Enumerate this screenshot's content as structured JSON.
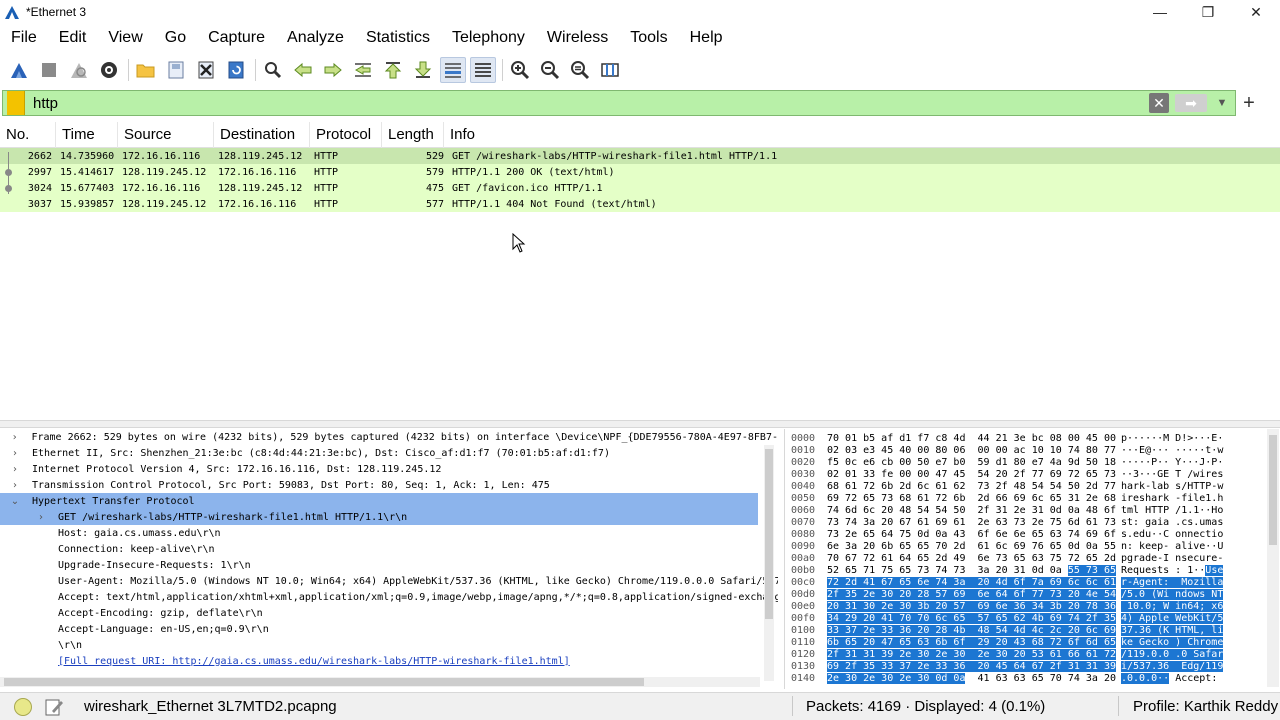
{
  "window": {
    "title": "*Ethernet 3",
    "minimize": "—",
    "restore": "❐",
    "close": "✕"
  },
  "menu": [
    "File",
    "Edit",
    "View",
    "Go",
    "Capture",
    "Analyze",
    "Statistics",
    "Telephony",
    "Wireless",
    "Tools",
    "Help"
  ],
  "toolbar": {
    "icons": [
      "start-capture-icon",
      "stop-capture-icon",
      "restart-capture-icon",
      "capture-options-icon",
      "open-file-icon",
      "save-file-icon",
      "close-file-icon",
      "reload-file-icon",
      "find-packet-icon",
      "go-back-icon",
      "go-forward-icon",
      "go-to-packet-icon",
      "first-packet-icon",
      "last-packet-icon",
      "auto-scroll-icon",
      "colorize-icon",
      "zoom-in-icon",
      "zoom-out-icon",
      "normal-size-icon",
      "resize-columns-icon"
    ]
  },
  "filter": {
    "value": "http",
    "clear": "✕",
    "apply": "➡",
    "dropdown": "▼",
    "add": "+"
  },
  "packet_list": {
    "columns": [
      "No.",
      "Time",
      "Source",
      "Destination",
      "Protocol",
      "Length",
      "Info"
    ],
    "rows": [
      {
        "no": "2662",
        "time": "14.735960",
        "src": "172.16.16.116",
        "dst": "128.119.245.12",
        "proto": "HTTP",
        "len": "529",
        "info": "GET /wireshark-labs/HTTP-wireshark-file1.html HTTP/1.1"
      },
      {
        "no": "2997",
        "time": "15.414617",
        "src": "128.119.245.12",
        "dst": "172.16.16.116",
        "proto": "HTTP",
        "len": "579",
        "info": "HTTP/1.1 200 OK  (text/html)"
      },
      {
        "no": "3024",
        "time": "15.677403",
        "src": "172.16.16.116",
        "dst": "128.119.245.12",
        "proto": "HTTP",
        "len": "475",
        "info": "GET /favicon.ico HTTP/1.1"
      },
      {
        "no": "3037",
        "time": "15.939857",
        "src": "128.119.245.12",
        "dst": "172.16.16.116",
        "proto": "HTTP",
        "len": "577",
        "info": "HTTP/1.1 404 Not Found  (text/html)"
      }
    ]
  },
  "details": [
    {
      "exp": "›",
      "text": "Frame 2662: 529 bytes on wire (4232 bits), 529 bytes captured (4232 bits) on interface \\Device\\NPF_{DDE79556-780A-4E97-8FB7-"
    },
    {
      "exp": "›",
      "text": "Ethernet II, Src: Shenzhen_21:3e:bc (c8:4d:44:21:3e:bc), Dst: Cisco_af:d1:f7 (70:01:b5:af:d1:f7)"
    },
    {
      "exp": "›",
      "text": "Internet Protocol Version 4, Src: 172.16.16.116, Dst: 128.119.245.12"
    },
    {
      "exp": "›",
      "text": "Transmission Control Protocol, Src Port: 59083, Dst Port: 80, Seq: 1, Ack: 1, Len: 475"
    },
    {
      "exp": "⌄",
      "text": "Hypertext Transfer Protocol"
    },
    {
      "exp": "›",
      "text": "GET /wireshark-labs/HTTP-wireshark-file1.html HTTP/1.1\\r\\n"
    },
    {
      "exp": "",
      "text": "Host: gaia.cs.umass.edu\\r\\n"
    },
    {
      "exp": "",
      "text": "Connection: keep-alive\\r\\n"
    },
    {
      "exp": "",
      "text": "Upgrade-Insecure-Requests: 1\\r\\n"
    },
    {
      "exp": "",
      "text": "User-Agent: Mozilla/5.0 (Windows NT 10.0; Win64; x64) AppleWebKit/537.36 (KHTML, like Gecko) Chrome/119.0.0.0 Safari/537"
    },
    {
      "exp": "",
      "text": "Accept: text/html,application/xhtml+xml,application/xml;q=0.9,image/webp,image/apng,*/*;q=0.8,application/signed-exchang"
    },
    {
      "exp": "",
      "text": "Accept-Encoding: gzip, deflate\\r\\n"
    },
    {
      "exp": "",
      "text": "Accept-Language: en-US,en;q=0.9\\r\\n"
    },
    {
      "exp": "",
      "text": "\\r\\n"
    },
    {
      "exp": "",
      "text": "[Full request URI: http://gaia.cs.umass.edu/wireshark-labs/HTTP-wireshark-file1.html]"
    }
  ],
  "bytes": [
    {
      "off": "0000",
      "hex": "70 01 b5 af d1 f7 c8 4d  44 21 3e bc 08 00 45 00",
      "asc": "p······M D!>···E·"
    },
    {
      "off": "0010",
      "hex": "02 03 e3 45 40 00 80 06  00 00 ac 10 10 74 80 77",
      "asc": "···E@··· ·····t·w"
    },
    {
      "off": "0020",
      "hex": "f5 0c e6 cb 00 50 e7 b0  59 d1 80 e7 4a 9d 50 18",
      "asc": "·····P·· Y···J·P·"
    },
    {
      "off": "0030",
      "hex": "02 01 33 fe 00 00 47 45  54 20 2f 77 69 72 65 73",
      "asc": "··3···GE T /wires"
    },
    {
      "off": "0040",
      "hex": "68 61 72 6b 2d 6c 61 62  73 2f 48 54 54 50 2d 77",
      "asc": "hark-lab s/HTTP-w"
    },
    {
      "off": "0050",
      "hex": "69 72 65 73 68 61 72 6b  2d 66 69 6c 65 31 2e 68",
      "asc": "ireshark -file1.h"
    },
    {
      "off": "0060",
      "hex": "74 6d 6c 20 48 54 54 50  2f 31 2e 31 0d 0a 48 6f",
      "asc": "tml HTTP /1.1··Ho"
    },
    {
      "off": "0070",
      "hex": "73 74 3a 20 67 61 69 61  2e 63 73 2e 75 6d 61 73",
      "asc": "st: gaia .cs.umas"
    },
    {
      "off": "0080",
      "hex": "73 2e 65 64 75 0d 0a 43  6f 6e 6e 65 63 74 69 6f",
      "asc": "s.edu··C onnectio"
    },
    {
      "off": "0090",
      "hex": "6e 3a 20 6b 65 65 70 2d  61 6c 69 76 65 0d 0a 55",
      "asc": "n: keep- alive··U"
    },
    {
      "off": "00a0",
      "hex": "70 67 72 61 64 65 2d 49  6e 73 65 63 75 72 65 2d",
      "asc": "pgrade-I nsecure-"
    },
    {
      "off": "00b0",
      "hex": "52 65 71 75 65 73 74 73  3a 20 31 0d 0a ",
      "hexhl": "55 73 65",
      "asc": "Requests : 1··",
      "aschl": "Use"
    },
    {
      "off": "00c0",
      "hexhl": "72 2d 41 67 65 6e 74 3a  20 4d 6f 7a 69 6c 6c 61",
      "aschl": "r-Agent:  Mozilla"
    },
    {
      "off": "00d0",
      "hexhl": "2f 35 2e 30 20 28 57 69  6e 64 6f 77 73 20 4e 54",
      "aschl": "/5.0 (Wi ndows NT"
    },
    {
      "off": "00e0",
      "hexhl": "20 31 30 2e 30 3b 20 57  69 6e 36 34 3b 20 78 36",
      "aschl": " 10.0; W in64; x6"
    },
    {
      "off": "00f0",
      "hexhl": "34 29 20 41 70 70 6c 65  57 65 62 4b 69 74 2f 35",
      "aschl": "4) Apple WebKit/5"
    },
    {
      "off": "0100",
      "hexhl": "33 37 2e 33 36 20 28 4b  48 54 4d 4c 2c 20 6c 69",
      "aschl": "37.36 (K HTML, li"
    },
    {
      "off": "0110",
      "hexhl": "6b 65 20 47 65 63 6b 6f  29 20 43 68 72 6f 6d 65",
      "aschl": "ke Gecko ) Chrome"
    },
    {
      "off": "0120",
      "hexhl": "2f 31 31 39 2e 30 2e 30  2e 30 20 53 61 66 61 72",
      "aschl": "/119.0.0 .0 Safar"
    },
    {
      "off": "0130",
      "hexhl": "69 2f 35 33 37 2e 33 36  20 45 64 67 2f 31 31 39",
      "aschl": "i/537.36  Edg/119"
    },
    {
      "off": "0140",
      "hexhl": "2e 30 2e 30 2e 30 0d 0a",
      "hex": "  41 63 63 65 70 74 3a 20",
      "aschl": ".0.0.0··",
      "asc": " Accept:"
    }
  ],
  "status": {
    "file": "wireshark_Ethernet 3L7MTD2.pcapng",
    "packets": "Packets: 4169 · Displayed: 4 (0.1%)",
    "profile": "Profile: Karthik Reddy"
  }
}
